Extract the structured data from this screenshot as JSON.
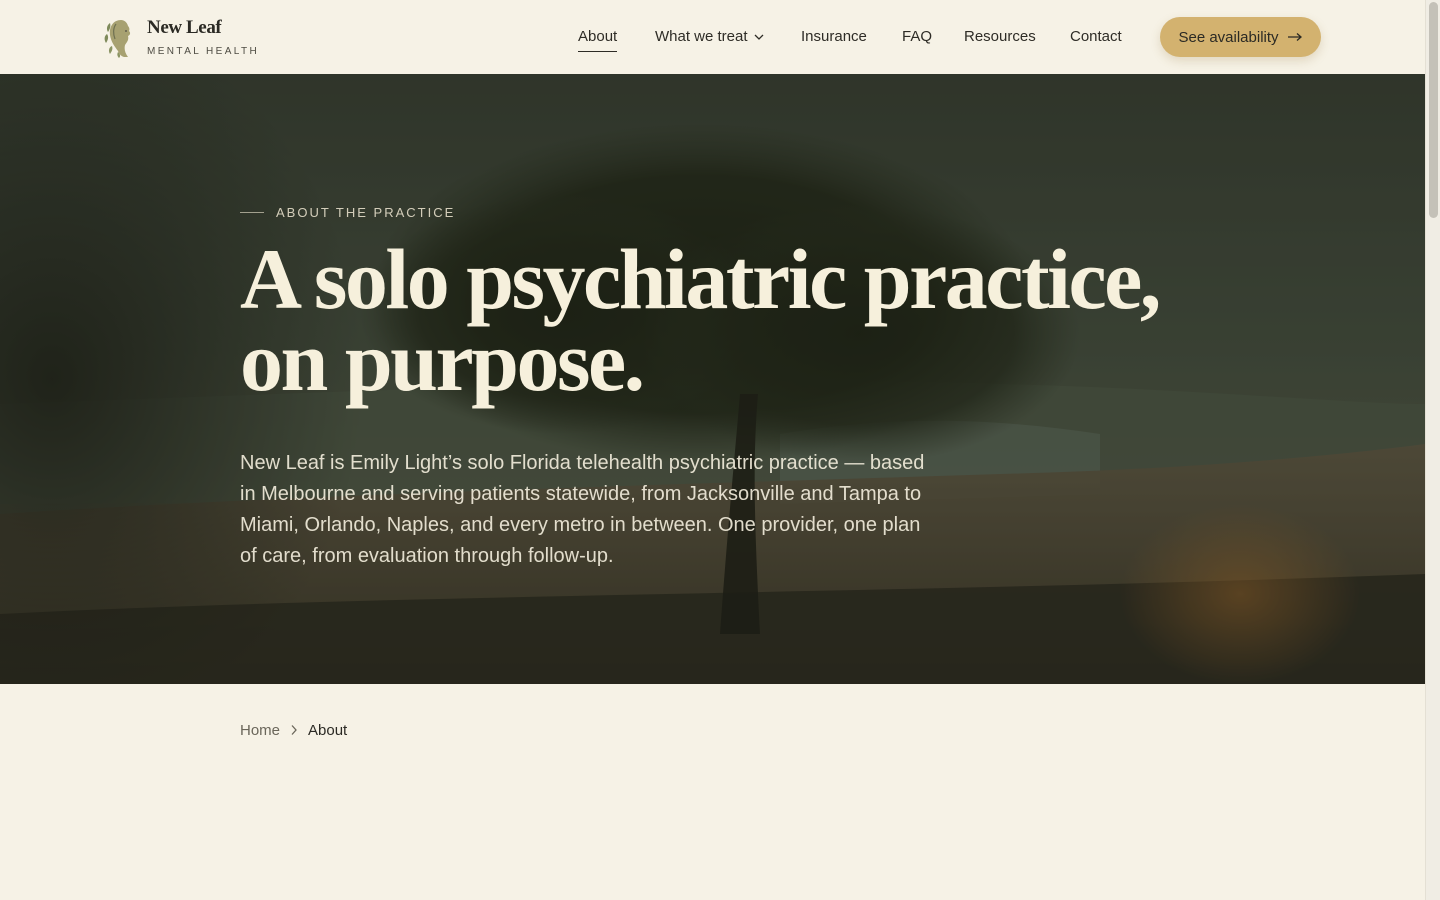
{
  "brand": {
    "name": "New Leaf",
    "tagline": "MENTAL HEALTH",
    "logo_icon": "leaf-woman-profile-icon"
  },
  "nav": {
    "items": [
      {
        "label": "About",
        "active": true
      },
      {
        "label": "What we treat",
        "has_dropdown": true
      },
      {
        "label": "Insurance"
      },
      {
        "label": "FAQ"
      },
      {
        "label": "Resources"
      },
      {
        "label": "Contact"
      }
    ],
    "cta_label": "See availability",
    "cta_icon": "arrow-right-icon"
  },
  "hero": {
    "eyebrow": "ABOUT THE PRACTICE",
    "title_line1": "A solo psychiatric practice,",
    "title_line2": "on purpose.",
    "body": "New Leaf is Emily Light’s solo Florida telehealth psychiatric practice — based in Melbourne and serving patients statewide, from Jacksonville and Tampa to Miami, Orlando, Naples, and every metro in between. One provider, one plan of care, from evaluation through follow-up."
  },
  "breadcrumb": {
    "home": "Home",
    "current": "About"
  },
  "colors": {
    "background": "#f6f2e6",
    "accent": "#d3b26f",
    "hero_text": "#f6f0dc",
    "ink": "#2b2a24"
  }
}
